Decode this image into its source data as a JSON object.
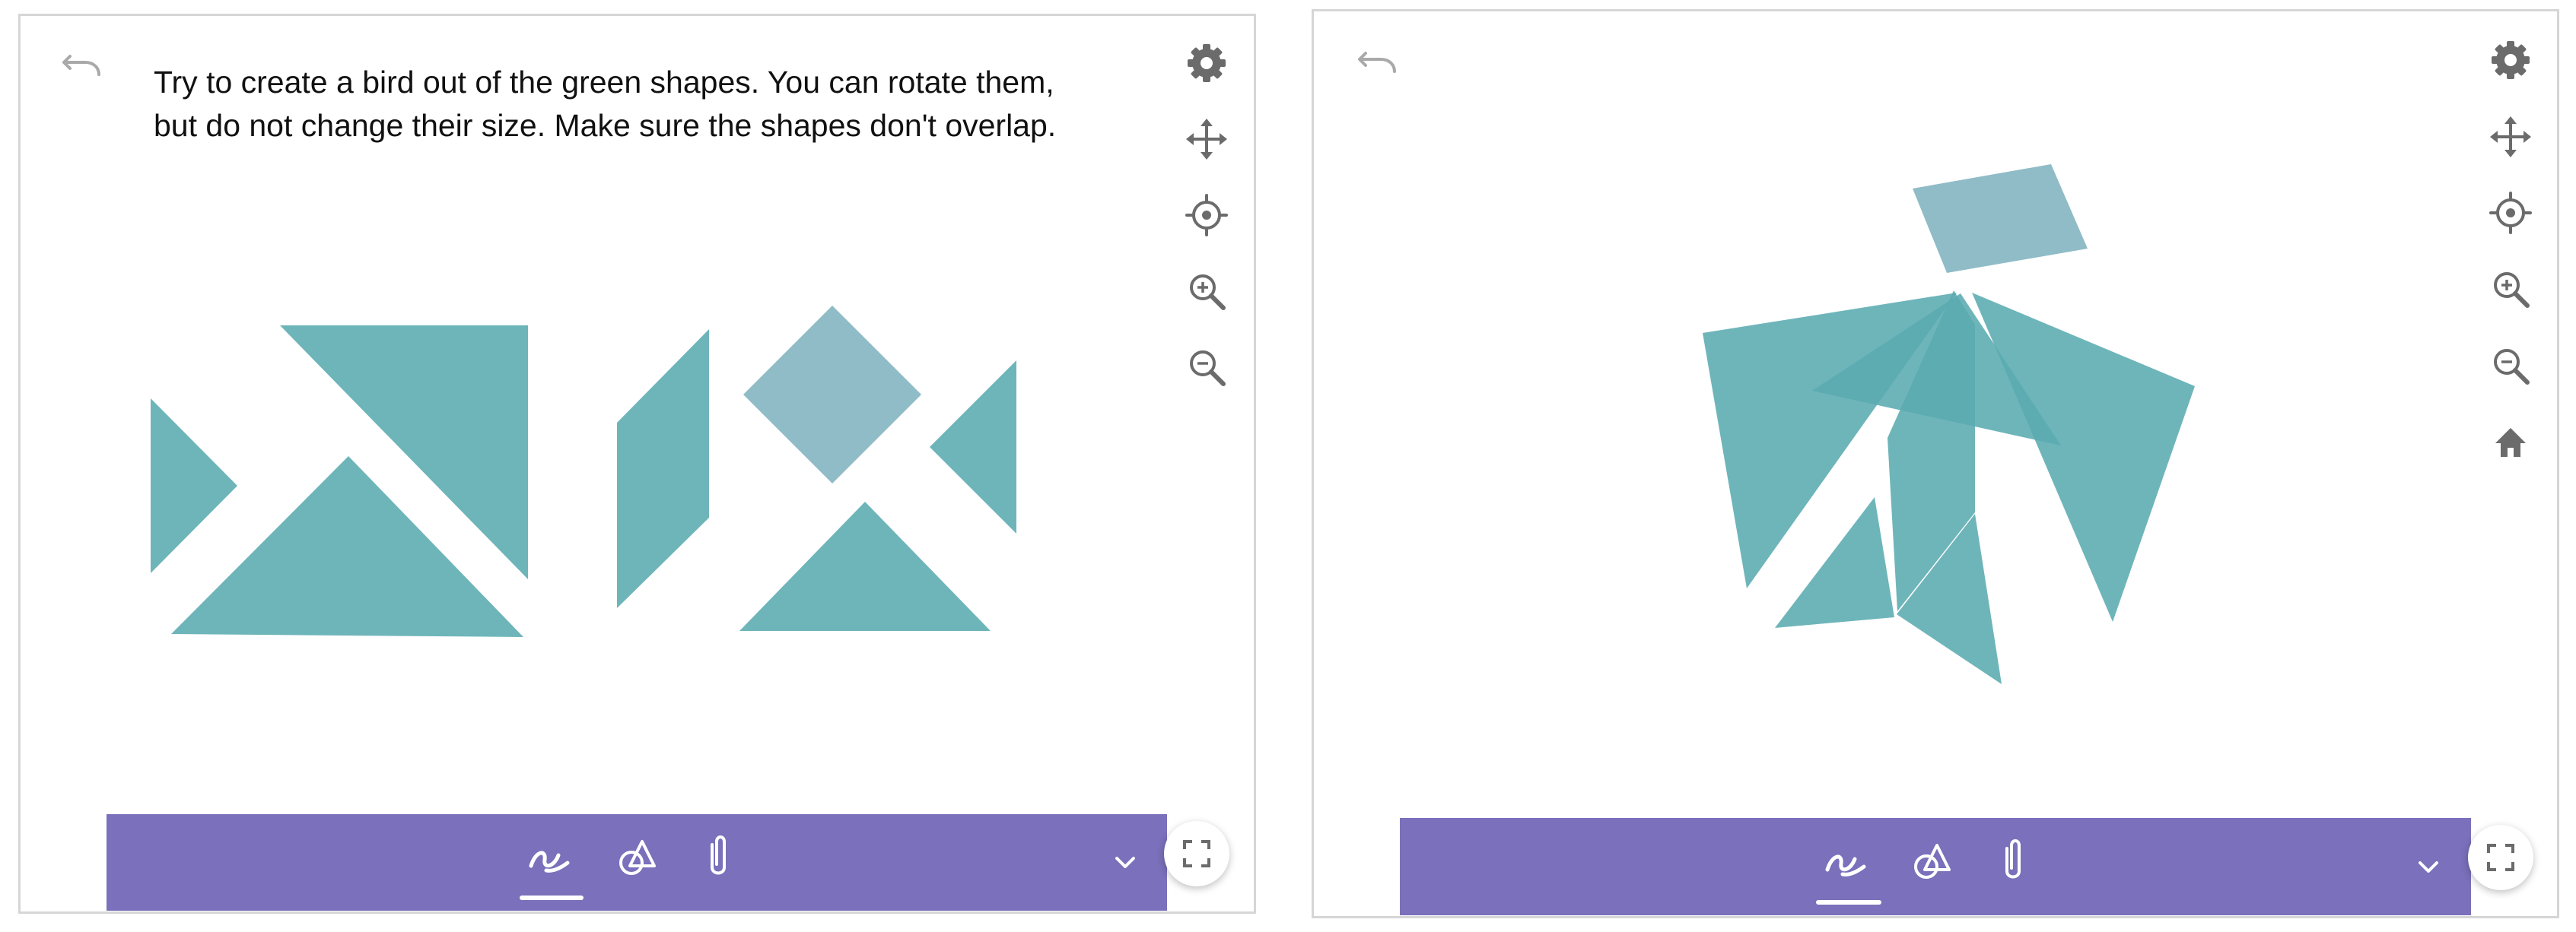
{
  "colors": {
    "shape_fill": "#5aabb1",
    "shape_light": "#8fbcc6",
    "toolbar": "#7a70bb",
    "icon_gray": "#6b6b6b",
    "undo_gray": "#a9a9a9",
    "frame_border": "#d6d6d6"
  },
  "left_panel": {
    "instructions": {
      "line1": "Try to create a bird out of the green shapes. You can rotate them,",
      "line2": "but do not change their size. Make sure the shapes don't overlap."
    },
    "tools": [
      "settings-icon",
      "move-icon",
      "crosshair-icon",
      "zoom-in-icon",
      "zoom-out-icon"
    ],
    "toolbar_icons": [
      "pen-icon",
      "shapes-icon",
      "attach-icon",
      "chevron-down-icon"
    ],
    "active_toolbar_icon": "pen-icon"
  },
  "right_panel": {
    "tools": [
      "settings-icon",
      "move-icon",
      "crosshair-icon",
      "zoom-in-icon",
      "zoom-out-icon",
      "home-icon"
    ],
    "toolbar_icons": [
      "pen-icon",
      "shapes-icon",
      "attach-icon",
      "chevron-down-icon"
    ],
    "active_toolbar_icon": "pen-icon"
  }
}
